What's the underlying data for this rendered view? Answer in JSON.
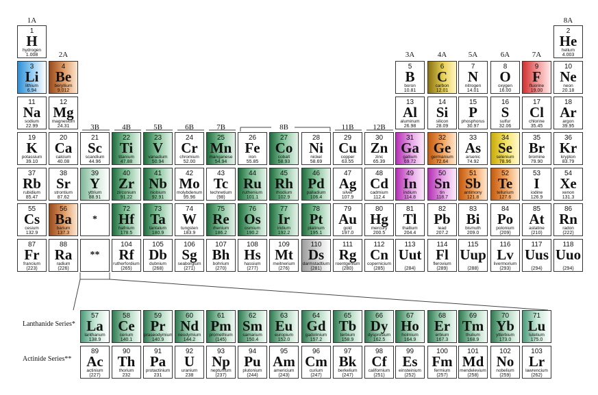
{
  "groups": [
    "1A",
    "2A",
    "3A",
    "4A",
    "5A",
    "6A",
    "7A",
    "8A",
    "3B",
    "4B",
    "5B",
    "6B",
    "7B",
    "8B",
    "11B",
    "12B"
  ],
  "series_labels": {
    "lanthanide": "Lanthanide Series*",
    "actinide": "Actinide Series**"
  },
  "placeholders": {
    "lanthanide": "*",
    "actinide": "**"
  },
  "elements": [
    {
      "n": "1",
      "s": "H",
      "name": "hydrogen",
      "m": "1.008"
    },
    {
      "n": "2",
      "s": "He",
      "name": "helium",
      "m": "4.003"
    },
    {
      "n": "3",
      "s": "Li",
      "name": "lithium",
      "m": "6.94"
    },
    {
      "n": "4",
      "s": "Be",
      "name": "beryllium",
      "m": "9.012"
    },
    {
      "n": "5",
      "s": "B",
      "name": "boron",
      "m": "10.81"
    },
    {
      "n": "6",
      "s": "C",
      "name": "carbon",
      "m": "12.01"
    },
    {
      "n": "7",
      "s": "N",
      "name": "nitrogen",
      "m": "14.01"
    },
    {
      "n": "8",
      "s": "O",
      "name": "oxygen",
      "m": "16.00"
    },
    {
      "n": "9",
      "s": "F",
      "name": "fluorine",
      "m": "19.00"
    },
    {
      "n": "10",
      "s": "Ne",
      "name": "neon",
      "m": "20.18"
    },
    {
      "n": "11",
      "s": "Na",
      "name": "sodium",
      "m": "22.99"
    },
    {
      "n": "12",
      "s": "Mg",
      "name": "magnesium",
      "m": "24.31"
    },
    {
      "n": "13",
      "s": "Al",
      "name": "aluminum",
      "m": "26.98"
    },
    {
      "n": "14",
      "s": "Si",
      "name": "silicon",
      "m": "28.09"
    },
    {
      "n": "15",
      "s": "P",
      "name": "phosphorus",
      "m": "30.97"
    },
    {
      "n": "16",
      "s": "S",
      "name": "sulfur",
      "m": "32.06"
    },
    {
      "n": "17",
      "s": "Cl",
      "name": "chlorine",
      "m": "35.45"
    },
    {
      "n": "18",
      "s": "Ar",
      "name": "argon",
      "m": "39.95"
    },
    {
      "n": "19",
      "s": "K",
      "name": "potassium",
      "m": "39.10"
    },
    {
      "n": "20",
      "s": "Ca",
      "name": "calcium",
      "m": "40.08"
    },
    {
      "n": "21",
      "s": "Sc",
      "name": "scandium",
      "m": "44.96"
    },
    {
      "n": "22",
      "s": "Ti",
      "name": "titanium",
      "m": "47.88"
    },
    {
      "n": "23",
      "s": "V",
      "name": "vanadium",
      "m": "50.94"
    },
    {
      "n": "24",
      "s": "Cr",
      "name": "chromium",
      "m": "52.00"
    },
    {
      "n": "25",
      "s": "Mn",
      "name": "manganese",
      "m": "54.94"
    },
    {
      "n": "26",
      "s": "Fe",
      "name": "iron",
      "m": "55.85"
    },
    {
      "n": "27",
      "s": "Co",
      "name": "cobalt",
      "m": "58.93"
    },
    {
      "n": "28",
      "s": "Ni",
      "name": "nickel",
      "m": "58.69"
    },
    {
      "n": "29",
      "s": "Cu",
      "name": "copper",
      "m": "63.55"
    },
    {
      "n": "30",
      "s": "Zn",
      "name": "zinc",
      "m": "65.39"
    },
    {
      "n": "31",
      "s": "Ga",
      "name": "gallium",
      "m": "69.72"
    },
    {
      "n": "32",
      "s": "Ge",
      "name": "germanium",
      "m": "72.64"
    },
    {
      "n": "33",
      "s": "As",
      "name": "arsenic",
      "m": "74.92"
    },
    {
      "n": "34",
      "s": "Se",
      "name": "selenium",
      "m": "78.96"
    },
    {
      "n": "35",
      "s": "Br",
      "name": "bromine",
      "m": "79.90"
    },
    {
      "n": "36",
      "s": "Kr",
      "name": "krypton",
      "m": "83.79"
    },
    {
      "n": "37",
      "s": "Rb",
      "name": "rubidium",
      "m": "85.47"
    },
    {
      "n": "38",
      "s": "Sr",
      "name": "strontium",
      "m": "87.62"
    },
    {
      "n": "39",
      "s": "Y",
      "name": "yttrium",
      "m": "88.91"
    },
    {
      "n": "40",
      "s": "Zr",
      "name": "zirconium",
      "m": "91.22"
    },
    {
      "n": "41",
      "s": "Nb",
      "name": "niobium",
      "m": "92.91"
    },
    {
      "n": "42",
      "s": "Mo",
      "name": "molybdenum",
      "m": "95.96"
    },
    {
      "n": "43",
      "s": "Tc",
      "name": "technetium",
      "m": "(98)"
    },
    {
      "n": "44",
      "s": "Ru",
      "name": "ruthenium",
      "m": "101.1"
    },
    {
      "n": "45",
      "s": "Rh",
      "name": "rhodium",
      "m": "102.9"
    },
    {
      "n": "46",
      "s": "Pd",
      "name": "palladium",
      "m": "106.4"
    },
    {
      "n": "47",
      "s": "Ag",
      "name": "silver",
      "m": "107.9"
    },
    {
      "n": "48",
      "s": "Cd",
      "name": "cadmium",
      "m": "112.4"
    },
    {
      "n": "49",
      "s": "In",
      "name": "indium",
      "m": "114.8"
    },
    {
      "n": "50",
      "s": "Sn",
      "name": "tin",
      "m": "118.7"
    },
    {
      "n": "51",
      "s": "Sb",
      "name": "antimony",
      "m": "121.8"
    },
    {
      "n": "52",
      "s": "Te",
      "name": "tellurium",
      "m": "127.6"
    },
    {
      "n": "53",
      "s": "I",
      "name": "iodine",
      "m": "126.9"
    },
    {
      "n": "54",
      "s": "Xe",
      "name": "xenon",
      "m": "131.3"
    },
    {
      "n": "55",
      "s": "Cs",
      "name": "cesium",
      "m": "132.9"
    },
    {
      "n": "56",
      "s": "Ba",
      "name": "barium",
      "m": "137.3"
    },
    {
      "n": "72",
      "s": "Hf",
      "name": "hafnium",
      "m": "178.5"
    },
    {
      "n": "73",
      "s": "Ta",
      "name": "tantalum",
      "m": "180.9"
    },
    {
      "n": "74",
      "s": "W",
      "name": "tungsten",
      "m": "183.9"
    },
    {
      "n": "75",
      "s": "Re",
      "name": "rhenium",
      "m": "186.2"
    },
    {
      "n": "76",
      "s": "Os",
      "name": "osmium",
      "m": "190.2"
    },
    {
      "n": "77",
      "s": "Ir",
      "name": "iridium",
      "m": "192.2"
    },
    {
      "n": "78",
      "s": "Pt",
      "name": "platinum",
      "m": "195.1"
    },
    {
      "n": "79",
      "s": "Au",
      "name": "gold",
      "m": "197.0"
    },
    {
      "n": "80",
      "s": "Hg",
      "name": "mercury",
      "m": "200.5"
    },
    {
      "n": "81",
      "s": "Tl",
      "name": "thallium",
      "m": "204.4"
    },
    {
      "n": "82",
      "s": "Pb",
      "name": "lead",
      "m": "207.2"
    },
    {
      "n": "83",
      "s": "Bi",
      "name": "bismuth",
      "m": "209.0"
    },
    {
      "n": "84",
      "s": "Po",
      "name": "polonium",
      "m": "(209)"
    },
    {
      "n": "85",
      "s": "At",
      "name": "astatine",
      "m": "(210)"
    },
    {
      "n": "86",
      "s": "Rn",
      "name": "radon",
      "m": "(222)"
    },
    {
      "n": "87",
      "s": "Fr",
      "name": "francium",
      "m": "(223)"
    },
    {
      "n": "88",
      "s": "Ra",
      "name": "radium",
      "m": "(226)"
    },
    {
      "n": "104",
      "s": "Rf",
      "name": "rutherfordium",
      "m": "(265)"
    },
    {
      "n": "105",
      "s": "Db",
      "name": "dubnium",
      "m": "(268)"
    },
    {
      "n": "106",
      "s": "Sg",
      "name": "seaborgium",
      "m": "(271)"
    },
    {
      "n": "107",
      "s": "Bh",
      "name": "bohrium",
      "m": "(270)"
    },
    {
      "n": "108",
      "s": "Hs",
      "name": "hassium",
      "m": "(277)"
    },
    {
      "n": "109",
      "s": "Mt",
      "name": "meitnerium",
      "m": "(276)"
    },
    {
      "n": "110",
      "s": "Ds",
      "name": "darmstadtium",
      "m": "(281)"
    },
    {
      "n": "111",
      "s": "Rg",
      "name": "roentgenium",
      "m": "(280)"
    },
    {
      "n": "112",
      "s": "Cn",
      "name": "copernicium",
      "m": "(285)"
    },
    {
      "n": "113",
      "s": "Uut",
      "name": "",
      "m": "(284)"
    },
    {
      "n": "114",
      "s": "Fl",
      "name": "flerovium",
      "m": "(289)"
    },
    {
      "n": "115",
      "s": "Uup",
      "name": "",
      "m": "(288)"
    },
    {
      "n": "116",
      "s": "Lv",
      "name": "livermorium",
      "m": "(293)"
    },
    {
      "n": "117",
      "s": "Uus",
      "name": "",
      "m": "(294)"
    },
    {
      "n": "118",
      "s": "Uuo",
      "name": "",
      "m": "(294)"
    },
    {
      "n": "57",
      "s": "La",
      "name": "lanthanum",
      "m": "138.9"
    },
    {
      "n": "58",
      "s": "Ce",
      "name": "cerium",
      "m": "140.1"
    },
    {
      "n": "59",
      "s": "Pr",
      "name": "praseodymium",
      "m": "140.9"
    },
    {
      "n": "60",
      "s": "Nd",
      "name": "neodymium",
      "m": "144.2"
    },
    {
      "n": "61",
      "s": "Pm",
      "name": "promethium",
      "m": "(145)"
    },
    {
      "n": "62",
      "s": "Sm",
      "name": "samarium",
      "m": "150.4"
    },
    {
      "n": "63",
      "s": "Eu",
      "name": "europium",
      "m": "152.0"
    },
    {
      "n": "64",
      "s": "Gd",
      "name": "gadolinium",
      "m": "157.2"
    },
    {
      "n": "65",
      "s": "Tb",
      "name": "terbium",
      "m": "158.9"
    },
    {
      "n": "66",
      "s": "Dy",
      "name": "dysprosium",
      "m": "162.5"
    },
    {
      "n": "67",
      "s": "Ho",
      "name": "holmium",
      "m": "164.9"
    },
    {
      "n": "68",
      "s": "Er",
      "name": "erbium",
      "m": "167.3"
    },
    {
      "n": "69",
      "s": "Tm",
      "name": "thulium",
      "m": "168.9"
    },
    {
      "n": "70",
      "s": "Yb",
      "name": "ytterbium",
      "m": "173.0"
    },
    {
      "n": "71",
      "s": "Lu",
      "name": "lutetium",
      "m": "175.0"
    },
    {
      "n": "89",
      "s": "Ac",
      "name": "actinium",
      "m": "(227)"
    },
    {
      "n": "90",
      "s": "Th",
      "name": "thorium",
      "m": "232"
    },
    {
      "n": "91",
      "s": "Pa",
      "name": "protactinium",
      "m": "231"
    },
    {
      "n": "92",
      "s": "U",
      "name": "uranium",
      "m": "238"
    },
    {
      "n": "93",
      "s": "Np",
      "name": "neptunium",
      "m": "(237)"
    },
    {
      "n": "94",
      "s": "Pu",
      "name": "plutonium",
      "m": "(244)"
    },
    {
      "n": "95",
      "s": "Am",
      "name": "americium",
      "m": "(243)"
    },
    {
      "n": "96",
      "s": "Cm",
      "name": "curium",
      "m": "(247)"
    },
    {
      "n": "97",
      "s": "Bk",
      "name": "berkelium",
      "m": "(247)"
    },
    {
      "n": "98",
      "s": "Cf",
      "name": "californium",
      "m": "(251)"
    },
    {
      "n": "99",
      "s": "Es",
      "name": "einsteinium",
      "m": "(252)"
    },
    {
      "n": "100",
      "s": "Fm",
      "name": "fermium",
      "m": "(257)"
    },
    {
      "n": "101",
      "s": "Md",
      "name": "mendelevium",
      "m": "(258)"
    },
    {
      "n": "102",
      "s": "No",
      "name": "nobelium",
      "m": "(259)"
    },
    {
      "n": "103",
      "s": "Lr",
      "name": "lawrencium",
      "m": "(262)"
    }
  ]
}
